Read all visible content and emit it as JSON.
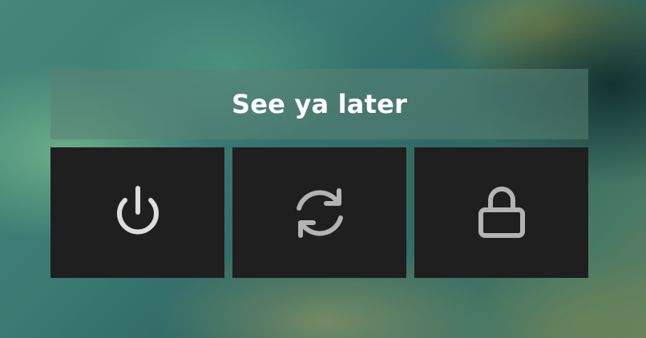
{
  "header": {
    "title": "See ya later"
  },
  "actions": [
    {
      "name": "shutdown",
      "icon": "power-icon"
    },
    {
      "name": "reboot",
      "icon": "refresh-icon"
    },
    {
      "name": "lock",
      "icon": "lock-icon"
    }
  ],
  "colors": {
    "tile_background": "#1f1f1f",
    "title_background": "#5a8273",
    "title_text": "#ffffff",
    "icon_power": "#dcdcdc",
    "icon_secondary": "#b3b3b3"
  }
}
